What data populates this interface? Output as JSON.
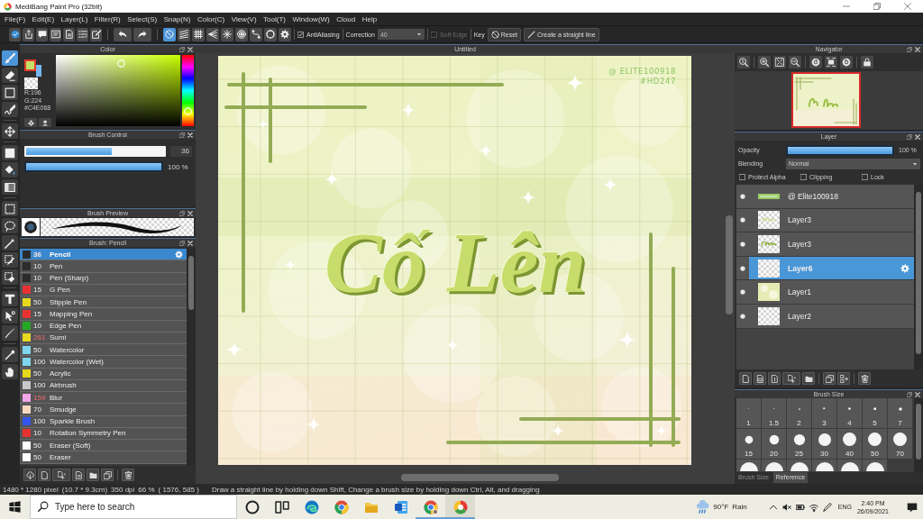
{
  "window": {
    "title": "MediBang Paint Pro (32bit)"
  },
  "menu": [
    "File(F)",
    "Edit(E)",
    "Layer(L)",
    "Filter(R)",
    "Select(S)",
    "Snap(N)",
    "Color(C)",
    "View(V)",
    "Tool(T)",
    "Window(W)",
    "Cloud",
    "Help"
  ],
  "toolbar": {
    "snap_modes": [
      {
        "kind": "off",
        "selected": true
      },
      {
        "kind": "parallel",
        "selected": false
      },
      {
        "kind": "grid",
        "selected": false
      },
      {
        "kind": "perspective",
        "selected": false
      },
      {
        "kind": "radial",
        "selected": false
      },
      {
        "kind": "concentric",
        "selected": false
      },
      {
        "kind": "curve",
        "selected": false
      },
      {
        "kind": "circle",
        "selected": false
      }
    ],
    "antialiasing": {
      "label": "AntiAliasing",
      "checked": true
    },
    "correction": {
      "label": "Correction",
      "value": "40"
    },
    "soft_edge": {
      "label": "Soft Edge",
      "checked": false,
      "disabled": true
    },
    "key_label": "Key",
    "buttons": [
      {
        "kind": "reset",
        "label": "Reset"
      },
      {
        "kind": "straight_line",
        "label": "Create a straight line"
      }
    ]
  },
  "tool_groups": [
    {
      "tools": [
        {
          "kind": "brush",
          "selected": true
        },
        {
          "kind": "eraser",
          "selected": false
        },
        {
          "kind": "dot",
          "selected": false
        },
        {
          "kind": "vector",
          "selected": false
        }
      ]
    },
    {
      "tools": [
        {
          "kind": "move",
          "selected": false
        }
      ]
    },
    {
      "tools": [
        {
          "kind": "fill",
          "selected": false
        },
        {
          "kind": "bucket",
          "selected": false
        },
        {
          "kind": "gradient",
          "selected": false
        }
      ]
    },
    {
      "tools": [
        {
          "kind": "select",
          "selected": false
        },
        {
          "kind": "lasso",
          "selected": false
        },
        {
          "kind": "wand",
          "selected": false
        },
        {
          "kind": "select_pen",
          "selected": false
        },
        {
          "kind": "select_eraser",
          "selected": false
        }
      ]
    },
    {
      "tools": [
        {
          "kind": "text",
          "selected": false
        },
        {
          "kind": "operation",
          "selected": false
        },
        {
          "kind": "divide",
          "selected": false
        }
      ]
    },
    {
      "tools": [
        {
          "kind": "eyedropper",
          "selected": false
        },
        {
          "kind": "hand",
          "selected": false
        }
      ]
    }
  ],
  "color_panel": {
    "title": "Color",
    "swatches": [
      {
        "kind": "foreground",
        "color": "#c4e068"
      },
      {
        "kind": "background",
        "color": "#78b8ee"
      }
    ],
    "red": "R:196",
    "green": "G:224",
    "hex": "#C4E068",
    "hue": {
      "level": 0.21
    }
  },
  "brush_control": {
    "title": "Brush Control",
    "size": {
      "level": 0.62,
      "value": "36"
    },
    "opacity": {
      "level": 1,
      "reading": "100 %"
    }
  },
  "brush_preview": {
    "title": "Brush Preview"
  },
  "brush_list": {
    "title": "Brush: Pencil",
    "items": [
      {
        "name": "Pencil",
        "size": "36",
        "color": "#2b2b2b",
        "size_changed": true,
        "selected": true
      },
      {
        "name": "Pen",
        "size": "10",
        "color": "#2b2b2b",
        "size_changed": false,
        "selected": false
      },
      {
        "name": "Pen (Sharp)",
        "size": "10",
        "color": "#2b2b2b",
        "size_changed": false,
        "selected": false
      },
      {
        "name": "G Pen",
        "size": "15",
        "color": "#e83232",
        "size_changed": false,
        "selected": false
      },
      {
        "name": "Stipple Pen",
        "size": "50",
        "color": "#e6d81e",
        "size_changed": false,
        "selected": false
      },
      {
        "name": "Mapping Pen",
        "size": "15",
        "color": "#e83232",
        "size_changed": false,
        "selected": false
      },
      {
        "name": "Edge Pen",
        "size": "10",
        "color": "#22aa22",
        "size_changed": false,
        "selected": false
      },
      {
        "name": "Sumi",
        "size": "261",
        "color": "#e6d81e",
        "size_changed": true,
        "selected": false
      },
      {
        "name": "Watercolor",
        "size": "50",
        "color": "#7fd4ee",
        "size_changed": false,
        "selected": false
      },
      {
        "name": "Watercolor (Wet)",
        "size": "100",
        "color": "#7fd4ee",
        "size_changed": false,
        "selected": false
      },
      {
        "name": "Acrylic",
        "size": "50",
        "color": "#e6d81e",
        "size_changed": false,
        "selected": false
      },
      {
        "name": "Airbrush",
        "size": "100",
        "color": "#c8c8c8",
        "size_changed": false,
        "selected": false
      },
      {
        "name": "Blur",
        "size": "159",
        "color": "#f2a6ea",
        "size_changed": true,
        "selected": false
      },
      {
        "name": "Smudge",
        "size": "70",
        "color": "#f8d8c0",
        "size_changed": false,
        "selected": false
      },
      {
        "name": "Sparkle Brush",
        "size": "100",
        "color": "#3355ee",
        "size_changed": false,
        "selected": false
      },
      {
        "name": "Rotation Symmetry Pen",
        "size": "10",
        "color": "#e83232",
        "size_changed": false,
        "selected": false
      },
      {
        "name": "Eraser (Soft)",
        "size": "50",
        "color": "#ffffff",
        "size_changed": false,
        "selected": false
      },
      {
        "name": "Eraser",
        "size": "50",
        "color": "#ffffff",
        "size_changed": false,
        "selected": false
      }
    ]
  },
  "canvas": {
    "title": "Untitled",
    "signature": "@ ELITE100918",
    "hashtag": "#HD247",
    "lettering": "Cố Lên"
  },
  "navigator": {
    "title": "Navigator"
  },
  "layer_panel": {
    "title": "Layer",
    "opacity_label": "Opacity",
    "opacity": {
      "level": 1,
      "reading": "100 %"
    },
    "blending_label": "Blending",
    "blending": "Normal",
    "options": [
      {
        "label": "Protect Alpha",
        "checked": false
      },
      {
        "label": "Clipping",
        "checked": false
      },
      {
        "label": "Lock",
        "checked": false
      }
    ],
    "layers": [
      {
        "name": "@ Elite100918",
        "kind": "banner",
        "visible": true,
        "selected": false
      },
      {
        "name": "Layer3",
        "kind": "lettering_faint",
        "visible": true,
        "selected": false
      },
      {
        "name": "Layer3",
        "kind": "lettering",
        "visible": true,
        "selected": false
      },
      {
        "name": "Layer6",
        "kind": "empty",
        "visible": true,
        "selected": true
      },
      {
        "name": "Layer1",
        "kind": "background",
        "visible": true,
        "selected": false
      },
      {
        "name": "Layer2",
        "kind": "empty",
        "visible": true,
        "selected": false
      }
    ]
  },
  "brush_size": {
    "title": "Brush Size",
    "sizes": [
      "1",
      "1.5",
      "2",
      "3",
      "4",
      "5",
      "7",
      "15",
      "20",
      "25",
      "30",
      "40",
      "50",
      "70"
    ],
    "tabs": [
      {
        "label": "Brush Size",
        "selected": true
      },
      {
        "label": "Reference",
        "selected": false
      }
    ]
  },
  "status_bar": {
    "items": [
      "1480 * 1280 pixel",
      "(10.7 * 9.3cm)",
      "350 dpi",
      "66 %",
      "( 1576, 585 )"
    ],
    "hint": "Draw a straight line by holding down Shift, Change a brush size by holding down Ctrl, Alt, and dragging"
  },
  "taskbar": {
    "search_placeholder": "Type here to search",
    "apps": [
      {
        "kind": "edge",
        "running": false,
        "active": false
      },
      {
        "kind": "chrome",
        "running": false,
        "active": false
      },
      {
        "kind": "explorer",
        "running": false,
        "active": false
      },
      {
        "kind": "word",
        "running": false,
        "active": false
      },
      {
        "kind": "chrome_profile",
        "running": true,
        "active": false
      },
      {
        "kind": "medibang",
        "running": true,
        "active": true
      }
    ],
    "temperature": "90°F",
    "weather": "Rain",
    "language": "ENG",
    "time": "2:40 PM",
    "date": "26/09/2021"
  }
}
